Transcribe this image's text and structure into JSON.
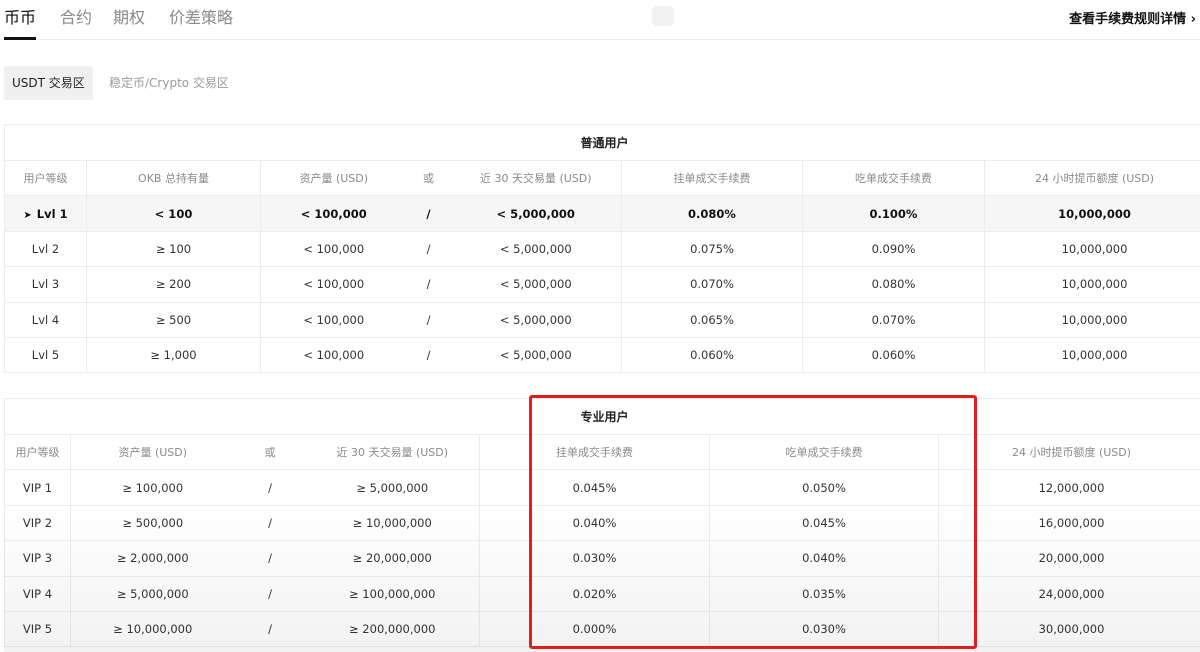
{
  "tabs": [
    "币币",
    "合约",
    "期权",
    "价差策略"
  ],
  "fee_link": "查看手续费规则详情 ›",
  "zones": [
    "USDT 交易区",
    "稳定币/Crypto 交易区"
  ],
  "normal": {
    "title": "普通用户",
    "headers": [
      "用户等级",
      "OKB 总持有量",
      "资产量 (USD)",
      "或",
      "近 30 天交易量 (USD)",
      "挂单成交手续费",
      "吃单成交手续费",
      "24 小时提币额度 (USD)"
    ],
    "marker": "➤",
    "rows": [
      [
        "Lvl 1",
        "< 100",
        "< 100,000",
        "/",
        "< 5,000,000",
        "0.080%",
        "0.100%",
        "10,000,000"
      ],
      [
        "Lvl 2",
        "≥ 100",
        "< 100,000",
        "/",
        "< 5,000,000",
        "0.075%",
        "0.090%",
        "10,000,000"
      ],
      [
        "Lvl 3",
        "≥ 200",
        "< 100,000",
        "/",
        "< 5,000,000",
        "0.070%",
        "0.080%",
        "10,000,000"
      ],
      [
        "Lvl 4",
        "≥ 500",
        "< 100,000",
        "/",
        "< 5,000,000",
        "0.065%",
        "0.070%",
        "10,000,000"
      ],
      [
        "Lvl 5",
        "≥ 1,000",
        "< 100,000",
        "/",
        "< 5,000,000",
        "0.060%",
        "0.060%",
        "10,000,000"
      ]
    ]
  },
  "pro": {
    "title": "专业用户",
    "headers": [
      "用户等级",
      "资产量 (USD)",
      "或",
      "近 30 天交易量 (USD)",
      "挂单成交手续费",
      "吃单成交手续费",
      "24 小时提币额度 (USD)"
    ],
    "rows": [
      [
        "VIP 1",
        "≥ 100,000",
        "/",
        "≥ 5,000,000",
        "0.045%",
        "0.050%",
        "12,000,000"
      ],
      [
        "VIP 2",
        "≥ 500,000",
        "/",
        "≥ 10,000,000",
        "0.040%",
        "0.045%",
        "16,000,000"
      ],
      [
        "VIP 3",
        "≥ 2,000,000",
        "/",
        "≥ 20,000,000",
        "0.030%",
        "0.040%",
        "20,000,000"
      ],
      [
        "VIP 4",
        "≥ 5,000,000",
        "/",
        "≥ 100,000,000",
        "0.020%",
        "0.035%",
        "24,000,000"
      ],
      [
        "VIP 5",
        "≥ 10,000,000",
        "/",
        "≥ 200,000,000",
        "0.000%",
        "0.030%",
        "30,000,000"
      ]
    ]
  },
  "colors": {
    "highlight_border": "#e0201f",
    "active_tab": "#111111",
    "muted_text": "#8a8a8a"
  }
}
